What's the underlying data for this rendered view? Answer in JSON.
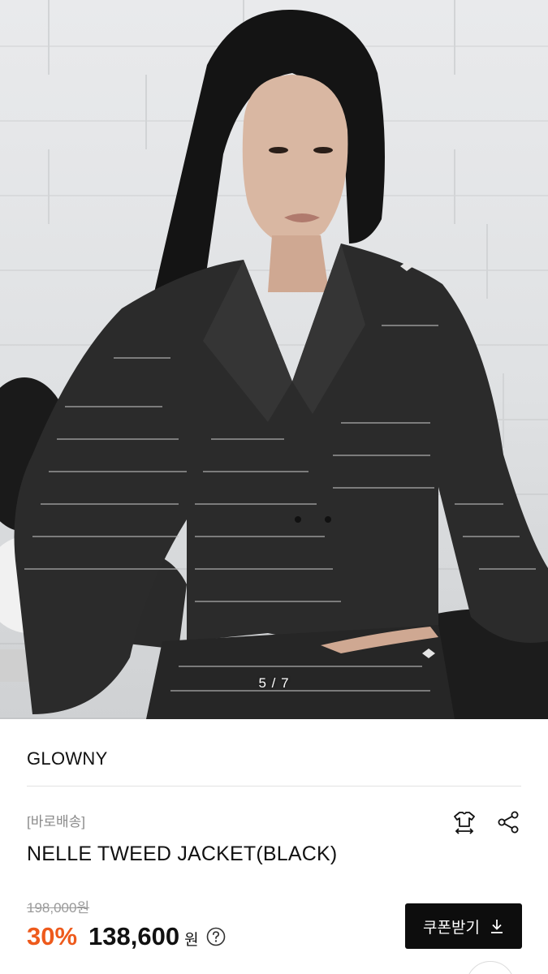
{
  "gallery": {
    "current": 5,
    "total": 7,
    "counter_text": "5 / 7"
  },
  "product": {
    "brand": "GLOWNY",
    "shipping_tag": "[바로배송]",
    "name": "NELLE TWEED JACKET(BLACK)",
    "original_price": "198,000원",
    "discount": "30%",
    "sale_price": "138,600",
    "currency": "원"
  },
  "actions": {
    "size_icon": "tshirt-size-icon",
    "share_icon": "share-icon",
    "help_icon": "question-circle-icon",
    "coupon_label": "쿠폰받기",
    "coupon_icon": "download-arrow-icon"
  },
  "colors": {
    "discount": "#ee5a1c",
    "button_bg": "#0d0d0d",
    "muted": "#8a8a8a"
  }
}
